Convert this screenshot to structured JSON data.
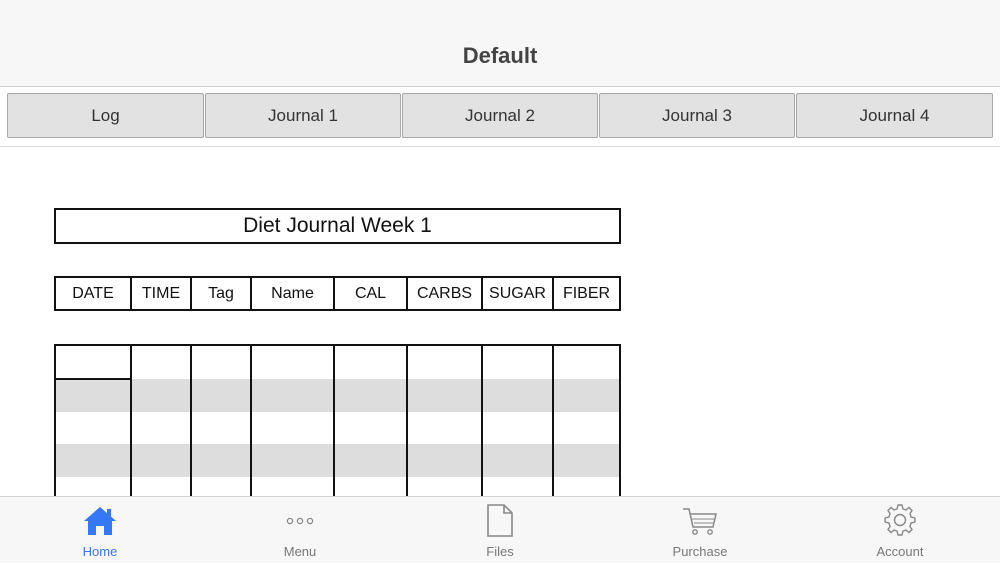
{
  "header": {
    "title": "Default"
  },
  "tabs": [
    {
      "label": "Log"
    },
    {
      "label": "Journal 1"
    },
    {
      "label": "Journal 2"
    },
    {
      "label": "Journal 3"
    },
    {
      "label": "Journal 4"
    }
  ],
  "journal": {
    "title": "Diet Journal Week 1",
    "columns": [
      "DATE",
      "TIME",
      "Tag",
      "Name",
      "CAL",
      "CARBS",
      "SUGAR",
      "FIBER"
    ]
  },
  "bottom_nav": {
    "active": "Home",
    "items": [
      {
        "label": "Home",
        "icon": "home-icon"
      },
      {
        "label": "Menu",
        "icon": "more-icon"
      },
      {
        "label": "Files",
        "icon": "file-icon"
      },
      {
        "label": "Purchase",
        "icon": "cart-icon"
      },
      {
        "label": "Account",
        "icon": "gear-icon"
      }
    ]
  },
  "colors": {
    "accent": "#3478f6",
    "inactive": "#777777",
    "tab_bg": "#e2e2e2",
    "row_band": "#dddddd"
  }
}
